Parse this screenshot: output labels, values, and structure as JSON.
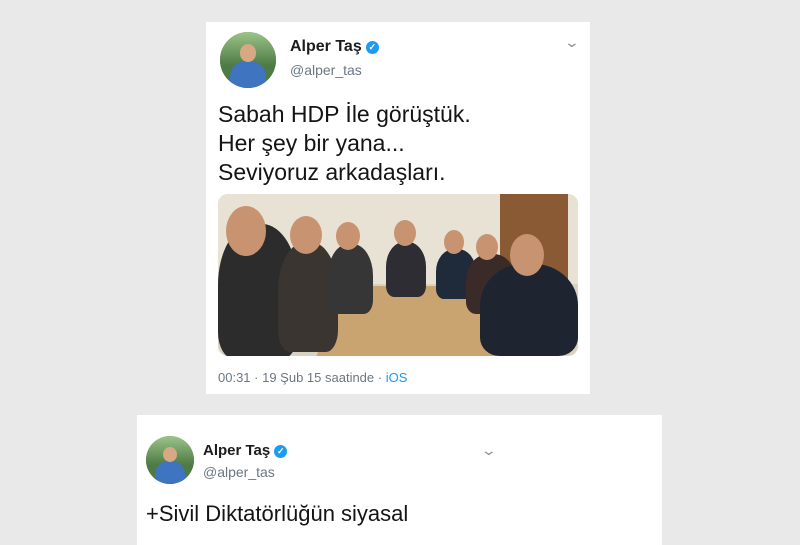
{
  "tweets": [
    {
      "name": "Alper Taş",
      "handle": "@alper_tas",
      "lines": [
        "Sabah HDP İle görüştük.",
        "Her şey bir yana...",
        "Seviyoruz arkadaşları."
      ],
      "time": "00:31",
      "sep": " · ",
      "date": "19 Şub 15 saatinde",
      "sep2": " · ",
      "source": "iOS"
    },
    {
      "name": "Alper Taş",
      "handle": "@alper_tas",
      "lines": [
        "+Sivil Diktatörlüğün siyasal"
      ]
    }
  ],
  "icons": {
    "verified": "verified-badge-icon",
    "menu": "chevron-down-icon"
  },
  "colors": {
    "link": "#1d9bf0",
    "background": "#e9e9e9"
  }
}
